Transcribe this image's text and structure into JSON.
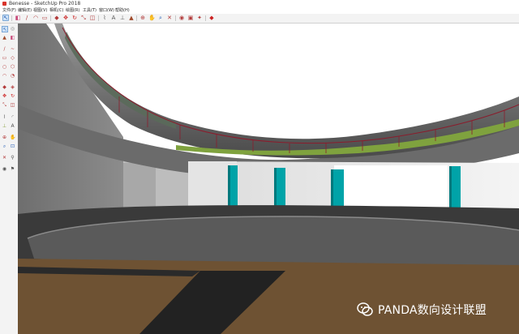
{
  "window": {
    "title": "Benesse - SketchUp Pro 2018"
  },
  "menu": [
    "文件(F)",
    "编辑(E)",
    "视图(V)",
    "相机(C)",
    "绘图(R)",
    "工具(T)",
    "窗口(W)",
    "帮助(H)"
  ],
  "toolbar": {
    "icons": [
      "select-icon",
      "eraser-icon",
      "line-icon",
      "arc-icon",
      "shape-icon",
      "pushpull-icon",
      "move-icon",
      "rotate-icon",
      "scale-icon",
      "offset-icon",
      "tape-icon",
      "text-icon",
      "axes-icon",
      "paint-icon",
      "orbit-icon",
      "pan-icon",
      "zoom-icon",
      "zoom-extents-icon",
      "section-icon",
      "warehouse-icon",
      "extension-icon",
      "ruby-icon"
    ]
  },
  "side_toolbar": {
    "icons": [
      "select-icon",
      "component-icon",
      "paint-icon",
      "eraser-icon",
      "line-icon",
      "freehand-icon",
      "rectangle-icon",
      "rotated-rect-icon",
      "circle-icon",
      "polygon-icon",
      "arc-icon",
      "pie-icon",
      "pushpull-icon",
      "followme-icon",
      "move-icon",
      "rotate-icon",
      "scale-icon",
      "offset-icon",
      "tape-icon",
      "protractor-icon",
      "axes-icon",
      "text-icon",
      "orbit-icon",
      "pan-icon",
      "zoom-icon",
      "zoom-window-icon",
      "section-icon",
      "walk-icon",
      "look-icon",
      "position-camera-icon"
    ]
  },
  "watermark": {
    "text": "PANDA数向设计联盟",
    "icon": "wechat-icon"
  },
  "colors": {
    "accent": "#00a3a8",
    "railing": "#8b1c2c",
    "floor": "#6e5233",
    "green_band": "#7fa23e"
  }
}
